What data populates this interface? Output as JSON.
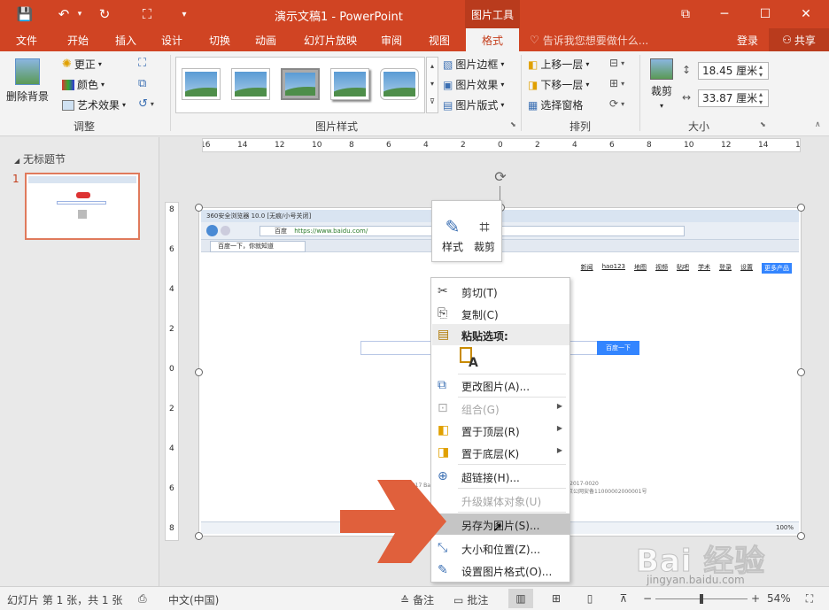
{
  "titlebar": {
    "title": "演示文稿1 - PowerPoint",
    "context_tab": "图片工具",
    "save_icon": "💾",
    "undo_icon": "↶",
    "redo_icon": "↻",
    "slideshow_icon": "⛶",
    "customize_icon": "▾",
    "restore_icon": "⧉",
    "minimize_icon": "─",
    "maximize_icon": "☐",
    "close_icon": "✕"
  },
  "tabs": [
    "文件",
    "开始",
    "插入",
    "设计",
    "切换",
    "动画",
    "幻灯片放映",
    "审阅",
    "视图",
    "格式"
  ],
  "tell_me": "告诉我您想要做什么...",
  "login": "登录",
  "share": "共享",
  "ribbon": {
    "remove_bg": "删除背景",
    "corrections": "更正",
    "color": "颜色",
    "artistic": "艺术效果",
    "group_adjust": "调整",
    "group_styles": "图片样式",
    "picture_border": "图片边框",
    "picture_effects": "图片效果",
    "picture_layout": "图片版式",
    "bring_forward": "上移一层",
    "send_backward": "下移一层",
    "selection_pane": "选择窗格",
    "group_arrange": "排列",
    "crop": "裁剪",
    "height": "18.45 厘米",
    "width": "33.87 厘米",
    "group_size": "大小"
  },
  "slides_pane": {
    "section": "无标题节",
    "slide_number": "1"
  },
  "ruler_h": [
    "16",
    "14",
    "12",
    "10",
    "8",
    "6",
    "4",
    "2",
    "0",
    "2",
    "4",
    "6",
    "8",
    "10",
    "12",
    "14",
    "16"
  ],
  "ruler_v": [
    "8",
    "6",
    "4",
    "2",
    "0",
    "2",
    "4",
    "6",
    "8"
  ],
  "screenshot": {
    "browser_title": "360安全浏览器 10.0 [无痕/小号关闭]",
    "url": "https://www.baidu.com/",
    "url_badge": "百度",
    "tab": "百度一下，你就知道",
    "links": [
      "新闻",
      "hao123",
      "地图",
      "视频",
      "贴吧",
      "学术",
      "登录",
      "设置"
    ],
    "more": "更多产品",
    "search_btn": "百度一下",
    "footer_left": "©2017 Baidu 使用百度前必读 意见反馈 京ICP证030173号",
    "footer_right": "-2017-0020",
    "footer_right2": "京公网安备11000002000001号",
    "zoom": "100%"
  },
  "minibar": {
    "style": "样式",
    "crop": "裁剪"
  },
  "context_menu": {
    "cut": "剪切(T)",
    "copy": "复制(C)",
    "paste_options": "粘贴选项:",
    "change_picture": "更改图片(A)...",
    "group": "组合(G)",
    "bring_to_front": "置于顶层(R)",
    "send_to_back": "置于底层(K)",
    "hyperlink": "超链接(H)...",
    "upgrade_media": "升级媒体对象(U)",
    "save_as_picture": "另存为图片(S)...",
    "size_position": "大小和位置(Z)...",
    "format_picture": "设置图片格式(O)..."
  },
  "statusbar": {
    "slide_info": "幻灯片 第 1 张，共 1 张",
    "language": "中文(中国)",
    "notes": "备注",
    "comments": "批注",
    "zoom": "54%",
    "zoom_minus": "−",
    "zoom_plus": "+"
  },
  "watermark": {
    "text": "Bai 经验",
    "url": "jingyan.baidu.com"
  },
  "colors": {
    "accent": "#d04423",
    "arrow": "#e0603c"
  }
}
